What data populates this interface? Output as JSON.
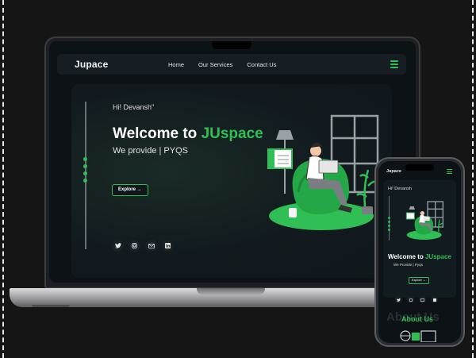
{
  "laptop": {
    "brand": "Jupace",
    "nav": [
      "Home",
      "Our Services",
      "Contact Us"
    ],
    "hero": {
      "greeting": "Hi! Devansh",
      "welcome_prefix": "Welcome to ",
      "welcome_accent": "JUspace",
      "tagline": "We provide | PYQS",
      "explore": "Explore"
    },
    "social_icons": [
      "twitter-icon",
      "instagram-icon",
      "mail-icon",
      "linkedin-icon"
    ]
  },
  "phone": {
    "brand": "Jupace",
    "hero": {
      "greeting": "Hi! Devansh",
      "welcome_prefix": "Welcome to ",
      "welcome_accent": "JUspace",
      "tagline": "We Provide  |  Pyqs",
      "explore": "Explore"
    },
    "about_bg": "About Us",
    "about": "About Us"
  },
  "colors": {
    "accent": "#2fbf54",
    "background": "#0c1216",
    "card": "#121a1f"
  }
}
